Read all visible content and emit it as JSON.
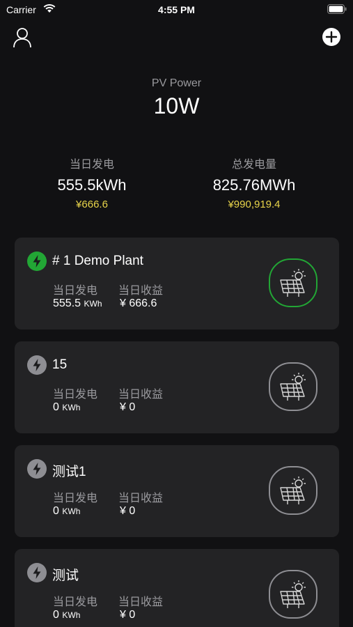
{
  "status_bar": {
    "carrier": "Carrier",
    "time": "4:55 PM"
  },
  "header": {
    "pv_label": "PV Power",
    "pv_value": "10W"
  },
  "summary": {
    "daily_label": "当日发电",
    "daily_value": "555.5kWh",
    "daily_money": "¥666.6",
    "total_label": "总发电量",
    "total_value": "825.76MWh",
    "total_money": "¥990,919.4"
  },
  "colors": {
    "active": "#22a635",
    "inactive": "#8e8e93",
    "money": "#e8d44a",
    "card": "#232325"
  },
  "plants": [
    {
      "name": "# 1 Demo Plant",
      "gen_label": "当日发电",
      "income_label": "当日收益",
      "gen_value": "555.5",
      "gen_unit": "KWh",
      "income_value": "¥ 666.6",
      "active": true
    },
    {
      "name": "15",
      "gen_label": "当日发电",
      "income_label": "当日收益",
      "gen_value": "0",
      "gen_unit": "KWh",
      "income_value": "¥ 0",
      "active": false
    },
    {
      "name": "测试1",
      "gen_label": "当日发电",
      "income_label": "当日收益",
      "gen_value": "0",
      "gen_unit": "KWh",
      "income_value": "¥ 0",
      "active": false
    },
    {
      "name": "测试",
      "gen_label": "当日发电",
      "income_label": "当日收益",
      "gen_value": "0",
      "gen_unit": "KWh",
      "income_value": "¥ 0",
      "active": false
    }
  ]
}
